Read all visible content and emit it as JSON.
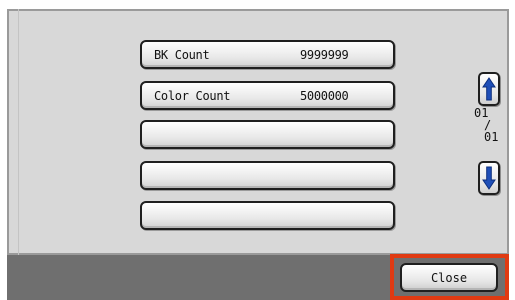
{
  "counters": [
    {
      "label": "BK Count",
      "value": "9999999"
    },
    {
      "label": "Color Count",
      "value": "5000000"
    },
    {
      "label": "",
      "value": ""
    },
    {
      "label": "",
      "value": ""
    },
    {
      "label": "",
      "value": ""
    }
  ],
  "pager": {
    "current": "01",
    "separator": "/",
    "total": "01",
    "up_icon": "arrow-up-icon",
    "down_icon": "arrow-down-icon"
  },
  "footer": {
    "close_label": "Close"
  },
  "colors": {
    "panel": "#d8d8d8",
    "bottom_bar": "#6f6f6f",
    "arrow": "#1f4fb8",
    "highlight": "#e03a12"
  }
}
